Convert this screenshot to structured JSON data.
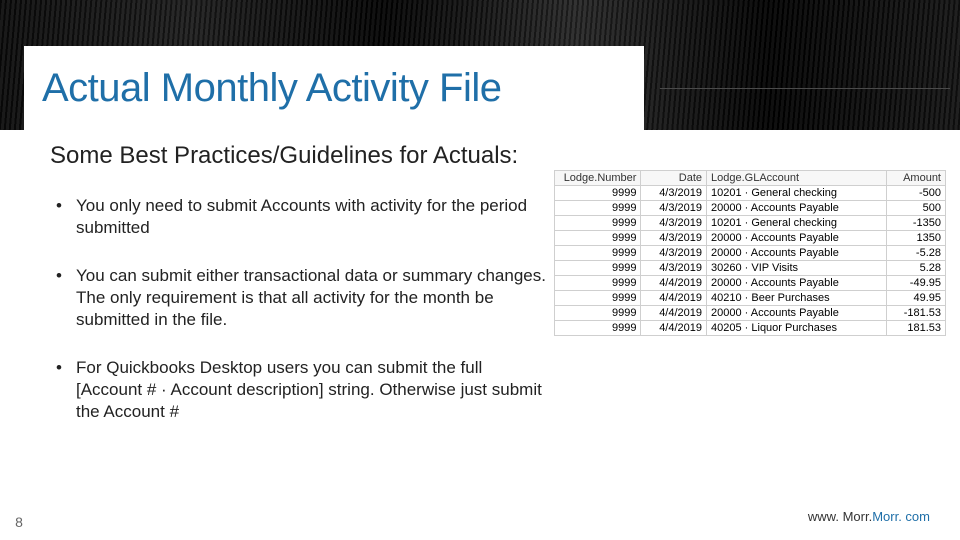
{
  "title": "Actual Monthly Activity File",
  "subheading": "Some Best Practices/Guidelines for Actuals:",
  "bullets": [
    "You only need to submit Accounts with activity for the period submitted",
    "You can submit either transactional data or summary changes. The only requirement is that all activity for the month be submitted in the file.",
    "For Quickbooks Desktop users you can submit the full [Account # · Account description] string. Otherwise just submit the Account #"
  ],
  "table": {
    "headers": [
      "Lodge.Number",
      "Date",
      "Lodge.GLAccount",
      "Amount"
    ],
    "rows": [
      [
        "9999",
        "4/3/2019",
        "10201 · General checking",
        "-500"
      ],
      [
        "9999",
        "4/3/2019",
        "20000 · Accounts Payable",
        "500"
      ],
      [
        "9999",
        "4/3/2019",
        "10201 · General checking",
        "-1350"
      ],
      [
        "9999",
        "4/3/2019",
        "20000 · Accounts Payable",
        "1350"
      ],
      [
        "9999",
        "4/3/2019",
        "20000 · Accounts Payable",
        "-5.28"
      ],
      [
        "9999",
        "4/3/2019",
        "30260 · VIP Visits",
        "5.28"
      ],
      [
        "9999",
        "4/4/2019",
        "20000 · Accounts Payable",
        "-49.95"
      ],
      [
        "9999",
        "4/4/2019",
        "40210 · Beer Purchases",
        "49.95"
      ],
      [
        "9999",
        "4/4/2019",
        "20000 · Accounts Payable",
        "-181.53"
      ],
      [
        "9999",
        "4/4/2019",
        "40205 · Liquor Purchases",
        "181.53"
      ]
    ]
  },
  "page_number": "8",
  "footer_url_prefix": "www. Morr.",
  "footer_url_suffix": "Morr. com"
}
